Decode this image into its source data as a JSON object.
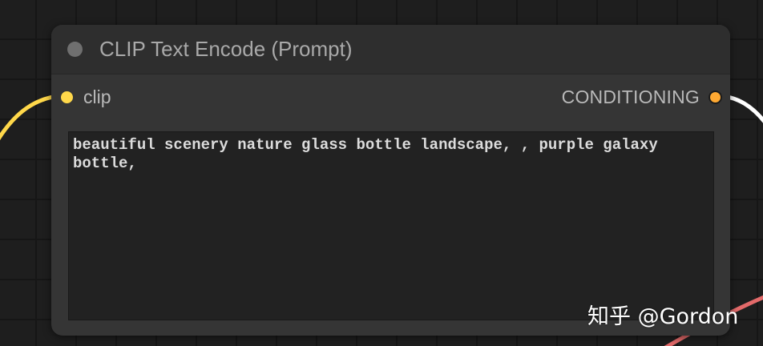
{
  "node": {
    "title": "CLIP Text Encode (Prompt)",
    "input_label": "clip",
    "output_label": "CONDITIONING",
    "prompt_text": "beautiful scenery nature glass bottle landscape, , purple galaxy bottle,"
  },
  "colors": {
    "clip_slot": "#ffd84a",
    "conditioning_slot": "#ffa932",
    "wire_clip": "#ffd84a",
    "wire_conditioning": "#ffffff",
    "wire_other": "#e36a6a",
    "status_dot": "#6f6f6f"
  },
  "icons": {
    "status": "circle-dot-icon",
    "input_slot": "yellow-circle-icon",
    "output_slot": "orange-circle-icon"
  },
  "watermark": "知乎 @Gordon"
}
